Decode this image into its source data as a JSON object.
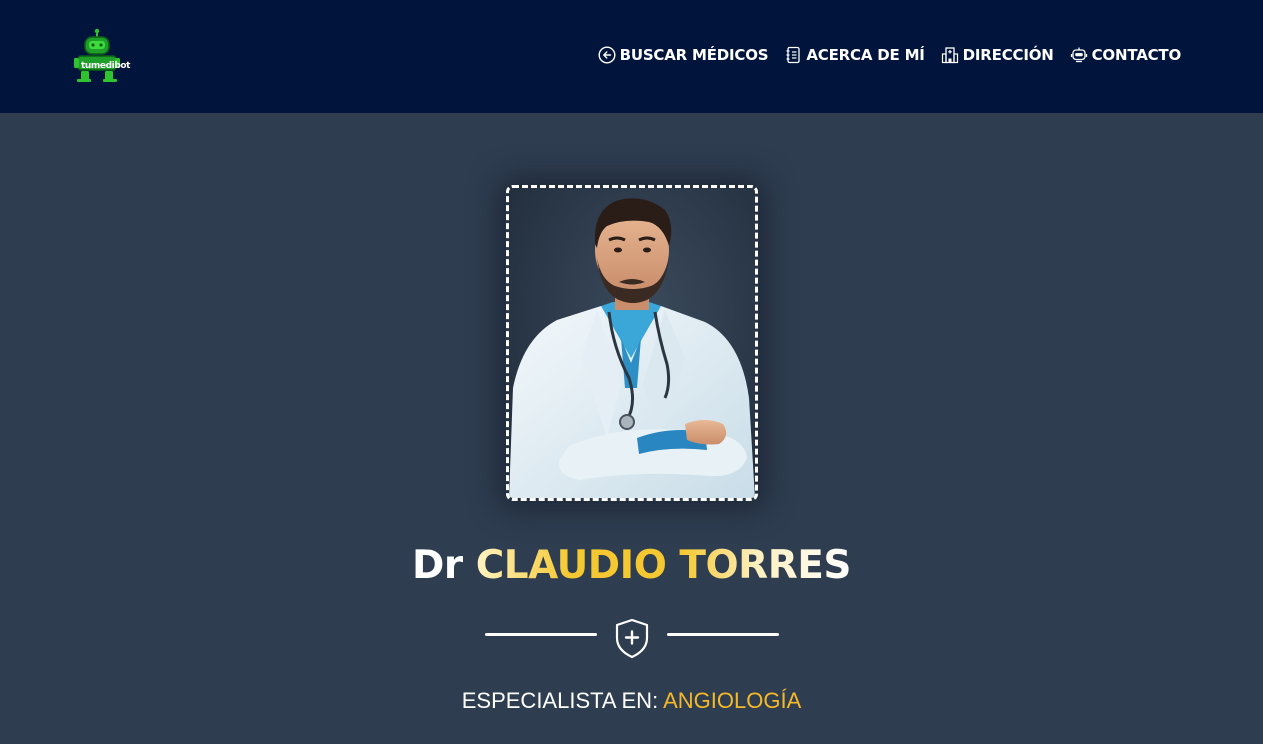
{
  "header": {
    "logo_text": "tumedibot",
    "nav": [
      {
        "label": "BUSCAR MÉDICOS",
        "icon": "arrow-left-circle-icon"
      },
      {
        "label": "ACERCA DE MÍ",
        "icon": "contact-book-icon"
      },
      {
        "label": "DIRECCIÓN",
        "icon": "building-icon"
      },
      {
        "label": "CONTACTO",
        "icon": "robot-icon"
      }
    ]
  },
  "profile": {
    "prefix": "Dr",
    "name": "CLAUDIO TORRES",
    "specialty_label": "ESPECIALISTA EN:",
    "specialty_value": "ANGIOLOGÍA"
  },
  "colors": {
    "navbar_bg": "#01143b",
    "page_bg": "#2e3d50",
    "accent": "#f5b928",
    "logo_green": "#2fc42f"
  }
}
